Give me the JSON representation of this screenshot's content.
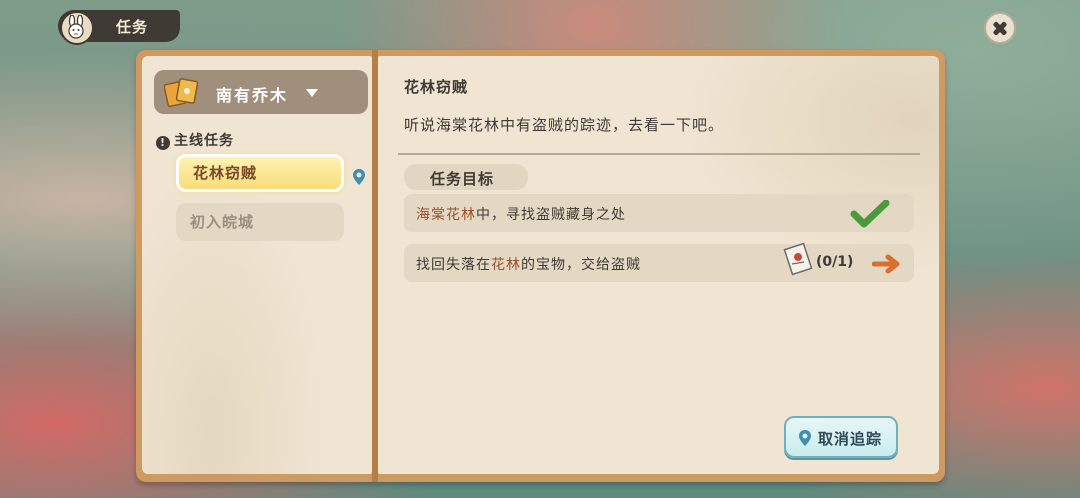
{
  "header": {
    "title": "任务"
  },
  "sidebar": {
    "region": "南有乔木",
    "category": "主线任务",
    "quests": [
      {
        "label": "花林窃贼",
        "active": true
      },
      {
        "label": "初入皖城",
        "active": false
      }
    ]
  },
  "quest": {
    "title": "花林窃贼",
    "description": "听说海棠花林中有盗贼的踪迹，去看一下吧。",
    "objectives_header": "任务目标",
    "objectives": [
      {
        "pre": "",
        "highlight": "海棠花林",
        "post": "中，寻找盗贼藏身之处",
        "status": "done"
      },
      {
        "pre": "找回失落在",
        "highlight": "花林",
        "post": "的宝物，交给盗贼",
        "progress": "(0/1)"
      }
    ]
  },
  "actions": {
    "cancel_track": "取消追踪"
  },
  "colors": {
    "accent": "#f7dc79",
    "check": "#4a9a3e",
    "arrow": "#d9702f",
    "highlight_text": "#9a4f2c"
  }
}
